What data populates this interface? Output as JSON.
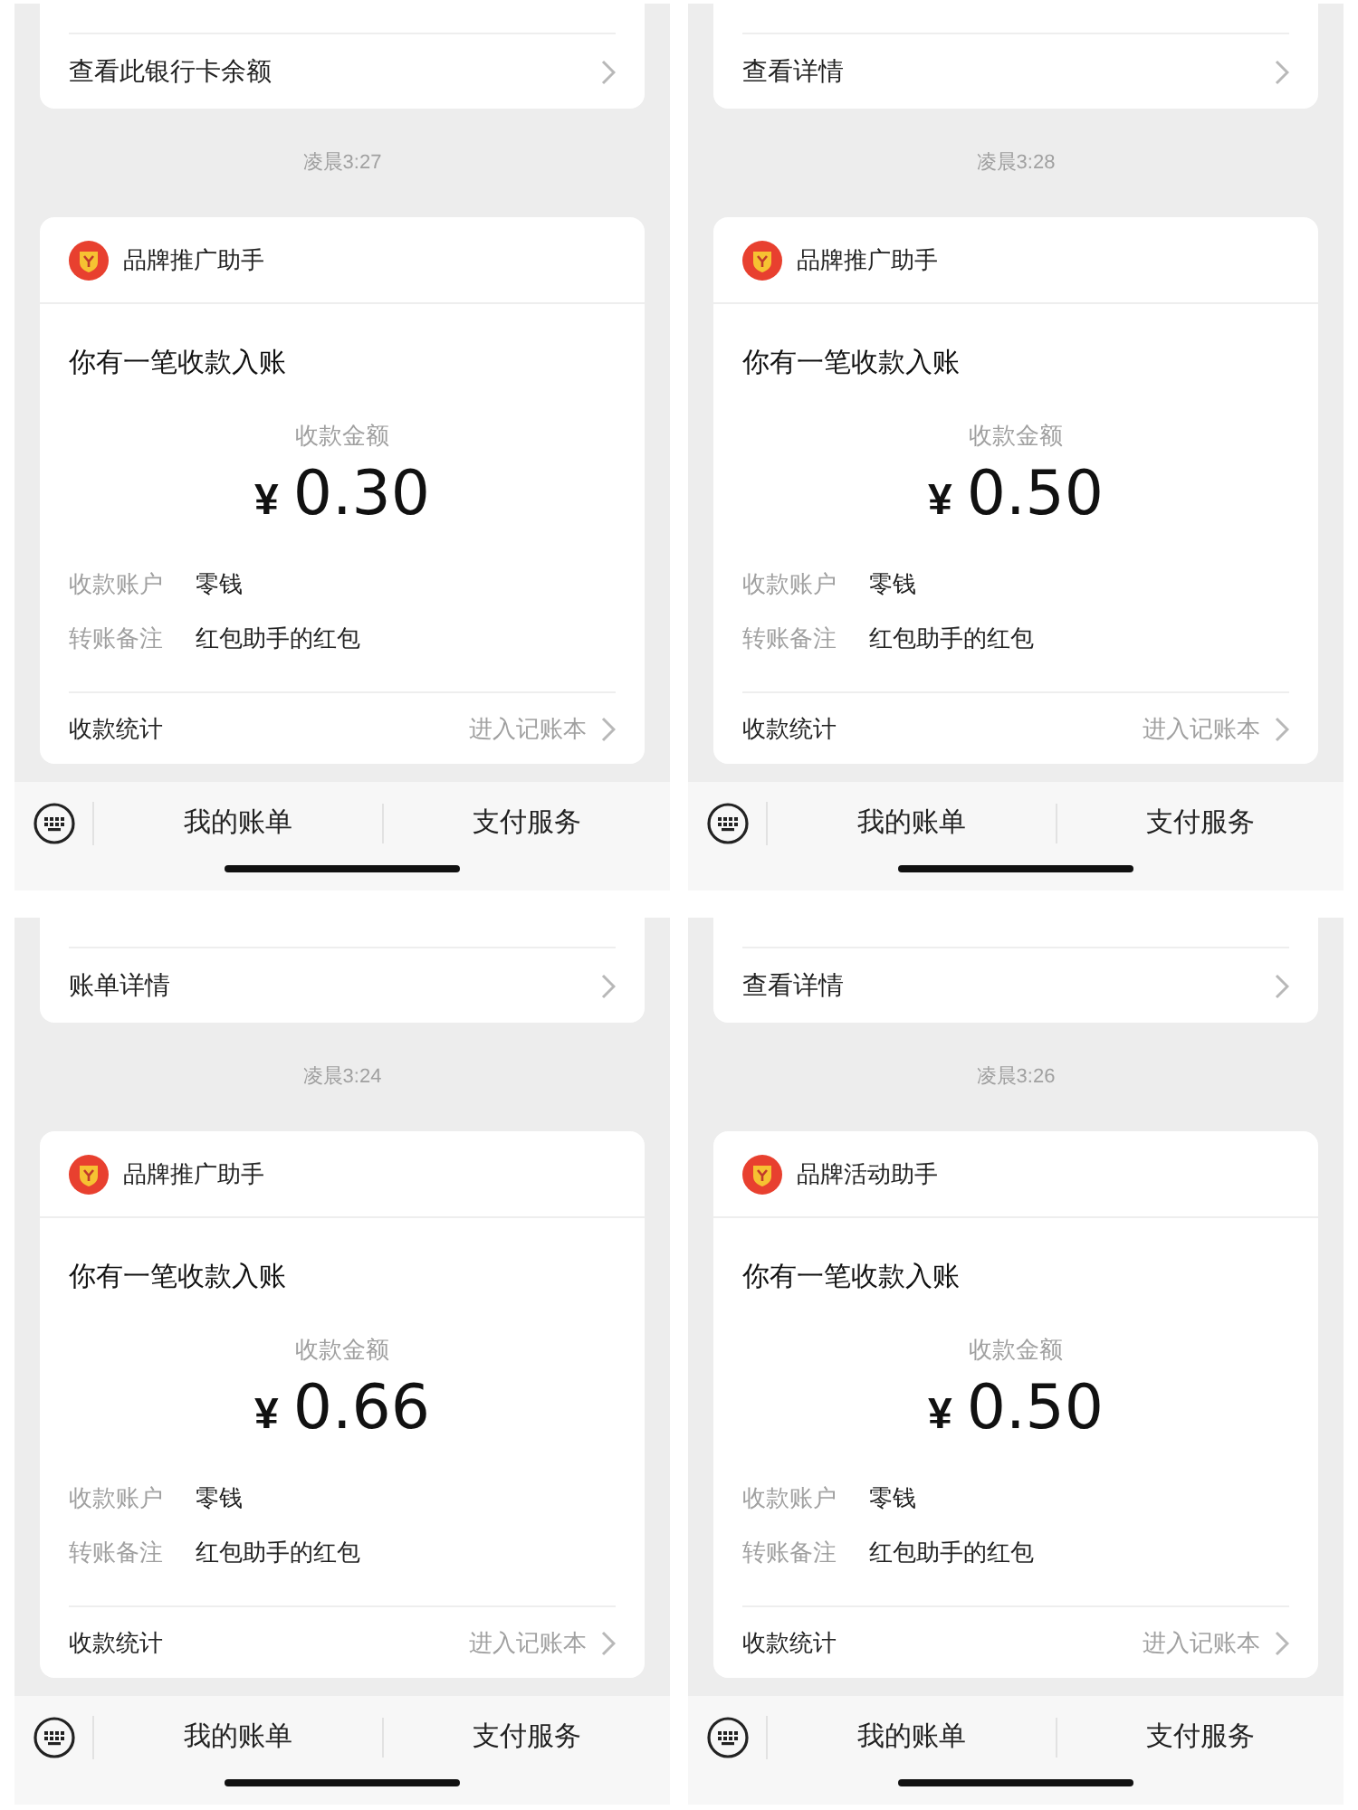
{
  "panels": [
    {
      "top_link": "查看此银行卡余额",
      "time": "凌晨3:27",
      "sender": "品牌推广助手",
      "title": "你有一笔收款入账",
      "amount_label": "收款金额",
      "currency": "¥",
      "amount": "0.30",
      "fields": [
        {
          "label": "收款账户",
          "value": "零钱"
        },
        {
          "label": "转账备注",
          "value": "红包助手的红包"
        }
      ],
      "stats_label": "收款统计",
      "stats_link": "进入记账本",
      "bottom_tabs": [
        "我的账单",
        "支付服务"
      ]
    },
    {
      "top_link": "查看详情",
      "time": "凌晨3:28",
      "sender": "品牌推广助手",
      "title": "你有一笔收款入账",
      "amount_label": "收款金额",
      "currency": "¥",
      "amount": "0.50",
      "fields": [
        {
          "label": "收款账户",
          "value": "零钱"
        },
        {
          "label": "转账备注",
          "value": "红包助手的红包"
        }
      ],
      "stats_label": "收款统计",
      "stats_link": "进入记账本",
      "bottom_tabs": [
        "我的账单",
        "支付服务"
      ]
    },
    {
      "top_link": "账单详情",
      "time": "凌晨3:24",
      "sender": "品牌推广助手",
      "title": "你有一笔收款入账",
      "amount_label": "收款金额",
      "currency": "¥",
      "amount": "0.66",
      "fields": [
        {
          "label": "收款账户",
          "value": "零钱"
        },
        {
          "label": "转账备注",
          "value": "红包助手的红包"
        }
      ],
      "stats_label": "收款统计",
      "stats_link": "进入记账本",
      "bottom_tabs": [
        "我的账单",
        "支付服务"
      ]
    },
    {
      "top_link": "查看详情",
      "time": "凌晨3:26",
      "sender": "品牌活动助手",
      "title": "你有一笔收款入账",
      "amount_label": "收款金额",
      "currency": "¥",
      "amount": "0.50",
      "fields": [
        {
          "label": "收款账户",
          "value": "零钱"
        },
        {
          "label": "转账备注",
          "value": "红包助手的红包"
        }
      ],
      "stats_label": "收款统计",
      "stats_link": "进入记账本",
      "bottom_tabs": [
        "我的账单",
        "支付服务"
      ]
    }
  ]
}
